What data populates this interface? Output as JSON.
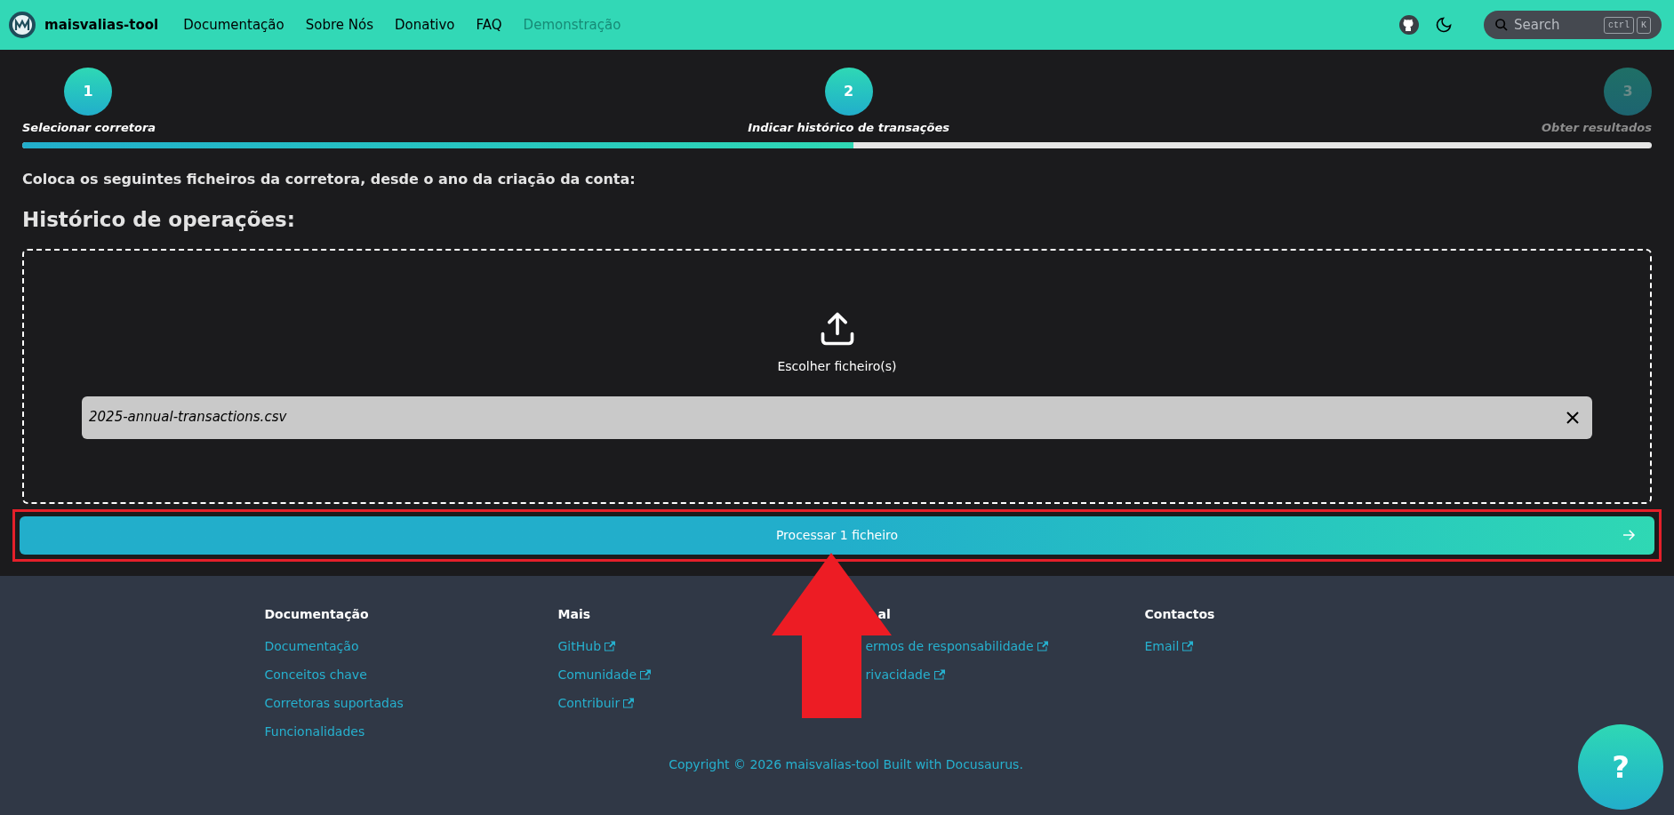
{
  "navbar": {
    "brand": "maisvalias-tool",
    "items": [
      {
        "label": "Documentação",
        "disabled": false
      },
      {
        "label": "Sobre Nós",
        "disabled": false
      },
      {
        "label": "Donativo",
        "disabled": false
      },
      {
        "label": "FAQ",
        "disabled": false
      },
      {
        "label": "Demonstração",
        "disabled": true
      }
    ],
    "search": {
      "placeholder": "Search",
      "keys": [
        "ctrl",
        "K"
      ]
    }
  },
  "stepper": {
    "steps": [
      {
        "number": "1",
        "label": "Selecionar corretora",
        "active": true
      },
      {
        "number": "2",
        "label": "Indicar histórico de transações",
        "active": true
      },
      {
        "number": "3",
        "label": "Obter resultados",
        "active": false
      }
    ],
    "level": 0.51
  },
  "intro": "Coloca os seguintes ficheiros da corretora, desde o ano da criação da conta:",
  "section_title": "Histórico de operações:",
  "dropzone": {
    "label": "Escolher ficheiro(s)",
    "files": [
      {
        "name": "2025-annual-transactions.csv"
      }
    ]
  },
  "submit_button": {
    "label": "Processar 1 ficheiro",
    "highlighted": true
  },
  "footer": {
    "columns": [
      {
        "title": "Documentação",
        "links": [
          {
            "label": "Documentação",
            "external": false
          },
          {
            "label": "Conceitos chave",
            "external": false
          },
          {
            "label": "Corretoras suportadas",
            "external": false
          },
          {
            "label": "Funcionalidades",
            "external": false
          }
        ]
      },
      {
        "title": "Mais",
        "links": [
          {
            "label": "GitHub",
            "external": true
          },
          {
            "label": "Comunidade",
            "external": true
          },
          {
            "label": "Contribuir",
            "external": true
          }
        ]
      },
      {
        "title": "al",
        "links": [
          {
            "label": "ermos de responsabilidade",
            "external": true
          },
          {
            "label": "rivacidade",
            "external": true
          }
        ]
      },
      {
        "title": "Contactos",
        "links": [
          {
            "label": "Email",
            "external": true
          }
        ]
      }
    ],
    "copyright": "Copyright © 2026 maisvalias-tool Built with Docusaurus."
  },
  "help_button": {
    "label": "?"
  }
}
